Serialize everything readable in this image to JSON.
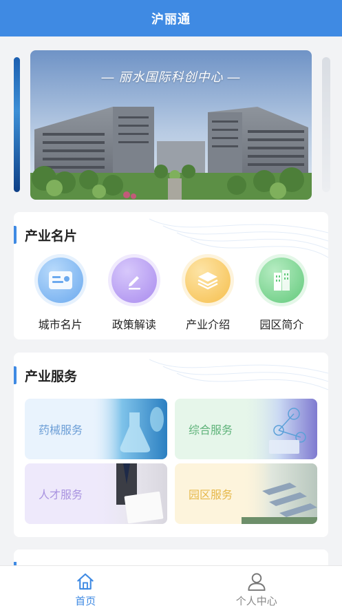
{
  "header": {
    "title": "沪丽通"
  },
  "banner": {
    "caption": "— 丽水国际科创中心 —"
  },
  "industry_cards": {
    "title": "产业名片",
    "items": [
      {
        "label": "城市名片",
        "icon": "id-card-icon"
      },
      {
        "label": "政策解读",
        "icon": "edit-pen-icon"
      },
      {
        "label": "产业介绍",
        "icon": "layers-icon"
      },
      {
        "label": "园区简介",
        "icon": "building-icon"
      }
    ]
  },
  "industry_services": {
    "title": "产业服务",
    "items": [
      {
        "label": "药械服务"
      },
      {
        "label": "综合服务"
      },
      {
        "label": "人才服务"
      },
      {
        "label": "园区服务"
      }
    ]
  },
  "tabbar": {
    "items": [
      {
        "label": "首页",
        "icon": "home-icon",
        "active": true
      },
      {
        "label": "个人中心",
        "icon": "user-icon",
        "active": false
      }
    ]
  },
  "colors": {
    "primary": "#3f8ae3",
    "tab_inactive": "#888888"
  }
}
